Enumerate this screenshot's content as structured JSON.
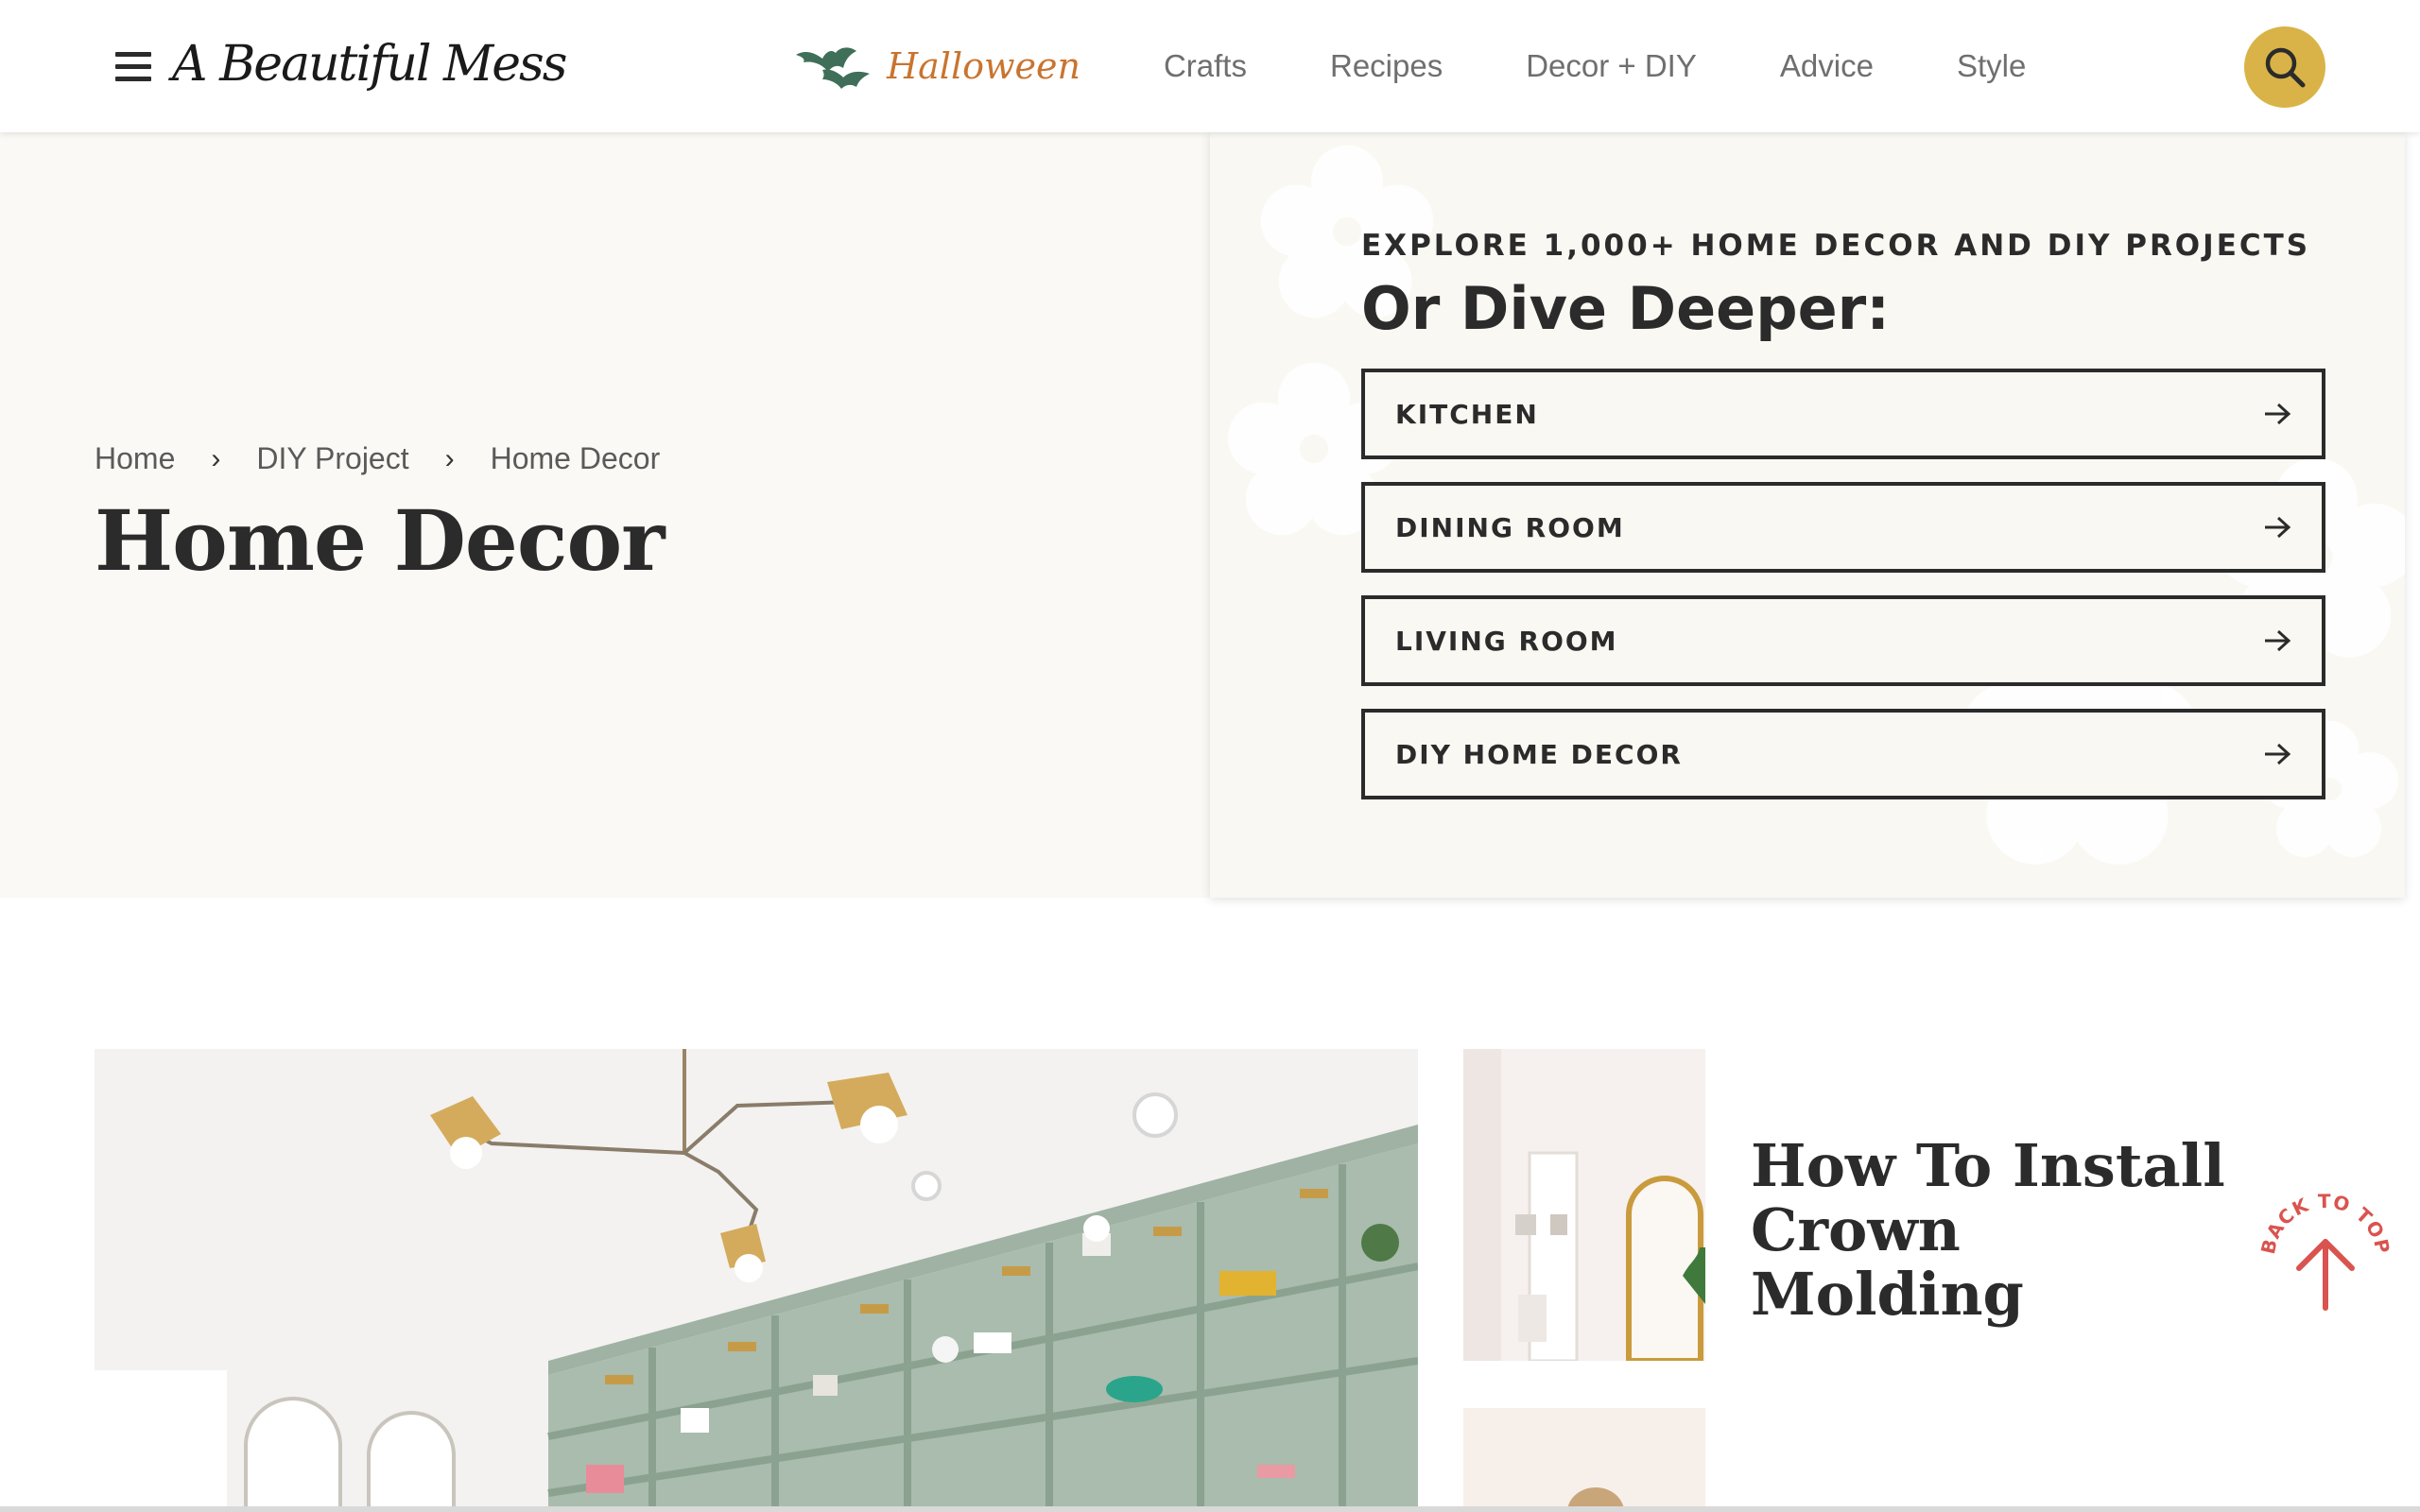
{
  "header": {
    "logo_text": "A Beautiful Mess",
    "nav": {
      "halloween": "Halloween",
      "items": [
        "Crafts",
        "Recipes",
        "Decor + DIY",
        "Advice",
        "Style"
      ]
    }
  },
  "breadcrumb": [
    "Home",
    "DIY Project",
    "Home Decor"
  ],
  "page_title": "Home Decor",
  "explore": {
    "eyebrow": "EXPLORE 1,000+ HOME DECOR AND DIY PROJECTS",
    "title": "Or Dive Deeper:",
    "categories": [
      "KITCHEN",
      "DINING ROOM",
      "LIVING ROOM",
      "DIY HOME DECOR"
    ]
  },
  "posts": [
    {
      "title": "How To Install Crown Molding"
    }
  ],
  "back_to_top": "BACK TO TOP",
  "colors": {
    "accent_yellow": "#d9b347",
    "halloween_orange": "#c9742f",
    "bat_green": "#3f6f58",
    "back_to_top_red": "#d9534f",
    "hero_bg": "#fbf9f5",
    "text_dark": "#2b2b2b"
  },
  "icons": [
    "hamburger-menu-icon",
    "bat-icon",
    "search-icon",
    "arrow-right-icon",
    "arrow-up-icon"
  ]
}
